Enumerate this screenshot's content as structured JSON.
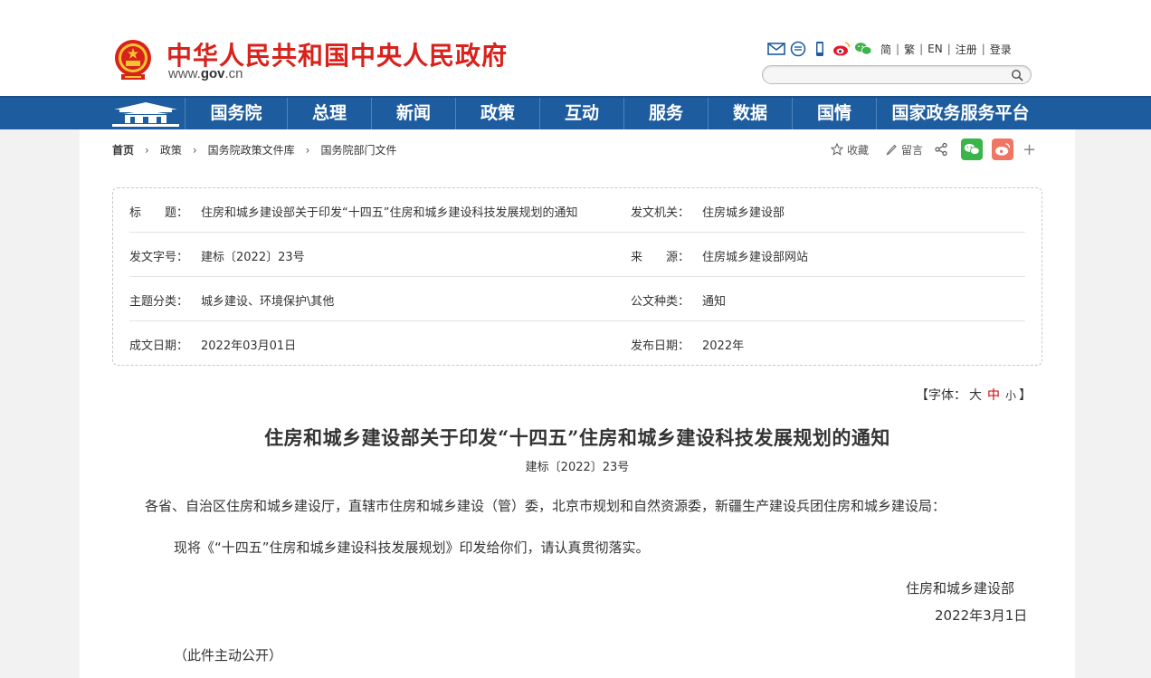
{
  "header": {
    "site_title": "中华人民共和国中央人民政府",
    "url_prefix": "www.",
    "url_domain": "gov",
    "url_suffix": ".cn",
    "lang_links": [
      "简",
      "繁",
      "EN",
      "注册",
      "登录"
    ],
    "share_icons": [
      "mail-icon",
      "chat-icon",
      "mobile-icon",
      "weibo-icon",
      "wechat-icon"
    ],
    "search": {
      "placeholder": "",
      "value": ""
    }
  },
  "nav": {
    "items": [
      "国务院",
      "总理",
      "新闻",
      "政策",
      "互动",
      "服务",
      "数据",
      "国情",
      "国家政务服务平台"
    ]
  },
  "breadcrumb": {
    "items": [
      "首页",
      "政策",
      "国务院政策文件库",
      "国务院部门文件"
    ]
  },
  "tools": {
    "collect": "收藏",
    "comment": "留言"
  },
  "meta": {
    "title_label": "标　　题：",
    "title_value": "住房和城乡建设部关于印发“十四五”住房和城乡建设科技发展规划的通知",
    "issuer_label": "发文机关：",
    "issuer_value": "住房城乡建设部",
    "docno_label": "发文字号：",
    "docno_value": "建标〔2022〕23号",
    "source_label": "来　　源：",
    "source_value": "住房城乡建设部网站",
    "topic_label": "主题分类：",
    "topic_value": "城乡建设、环境保护\\其他",
    "type_label": "公文种类：",
    "type_value": "通知",
    "written_label": "成文日期：",
    "written_value": "2022年03月01日",
    "published_label": "发布日期：",
    "published_value": "2022年"
  },
  "fontsize": {
    "prefix": "【字体：",
    "large": "大",
    "medium": "中",
    "small": "小",
    "suffix": "】"
  },
  "article": {
    "title": "住房和城乡建设部关于印发“十四五”住房和城乡建设科技发展规划的通知",
    "docno": "建标〔2022〕23号",
    "para1": "各省、自治区住房和城乡建设厅，直辖市住房和城乡建设（管）委，北京市规划和自然资源委，新疆生产建设兵团住房和城乡建设局：",
    "para2": "现将《“十四五”住房和城乡建设科技发展规划》印发给你们，请认真贯彻落实。",
    "sign_org": "住房和城乡建设部",
    "sign_date": "2022年3月1日",
    "public_note": "（此件主动公开）"
  },
  "colors": {
    "brand_red": "#d8221b",
    "nav_blue": "#1d5c9e",
    "wechat_green": "#3bb44a",
    "weibo_red": "#f07565"
  }
}
